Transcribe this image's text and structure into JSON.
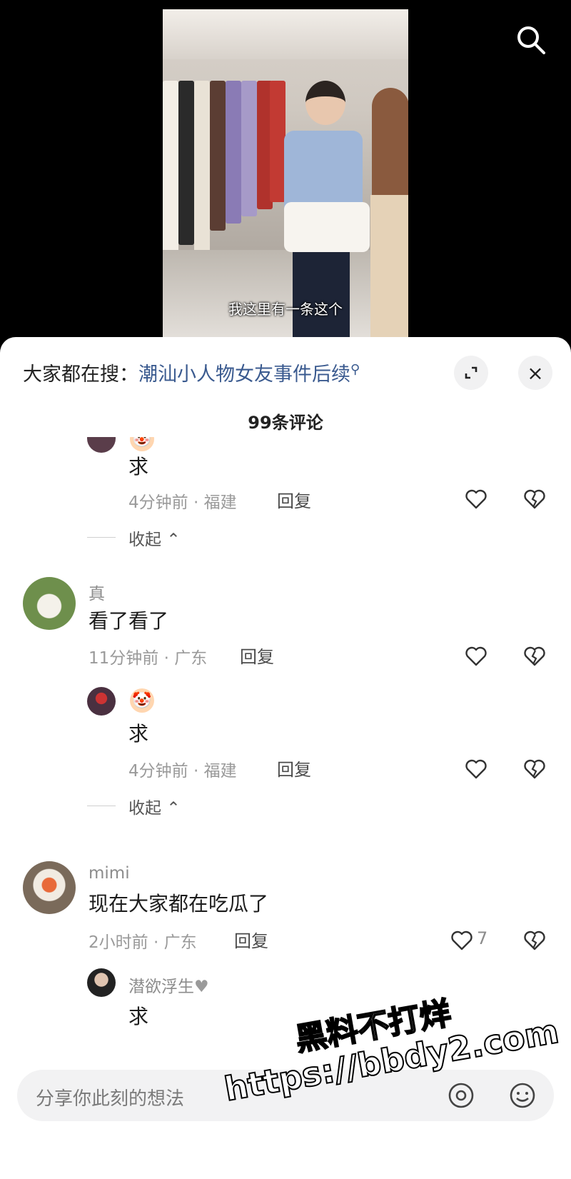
{
  "video": {
    "subtitle": "我这里有一条这个"
  },
  "top_bar": {
    "search_icon": "search-icon"
  },
  "sheet": {
    "hot_search_prefix": "大家都在搜：",
    "hot_search_link": "潮汕小人物女友事件后续",
    "hot_search_link_icon": "search-icon",
    "expand_icon": "expand-icon",
    "close_icon": "×",
    "comment_count": "99条评论"
  },
  "comments": [
    {
      "id": "reply-partial",
      "text": "求",
      "time_location": "4分钟前 · 福建",
      "reply_label": "回复",
      "collapse_label": "收起"
    },
    {
      "id": "comment-zhen",
      "username": "真",
      "text": "看了看了",
      "time_location": "11分钟前 · 广东",
      "reply_label": "回复",
      "reply": {
        "badge_emoji": "🤡",
        "text": "求",
        "time_location": "4分钟前 · 福建",
        "reply_label": "回复"
      },
      "collapse_label": "收起"
    },
    {
      "id": "comment-mimi",
      "username": "mimi",
      "text": "现在大家都在吃瓜了",
      "time_location": "2小时前 · 广东",
      "reply_label": "回复",
      "like_count": "7",
      "reply": {
        "username": "潜欲浮生",
        "username_suffix": "♥",
        "text": "求"
      }
    }
  ],
  "input": {
    "placeholder": "分享你此刻的想法"
  },
  "watermark": {
    "line1": "黑料不打烊",
    "line2": "https://bbdy2.com"
  },
  "colors": {
    "link": "#3a5a8f",
    "meta": "#9a9a9a",
    "sheet_bg": "#ffffff"
  }
}
